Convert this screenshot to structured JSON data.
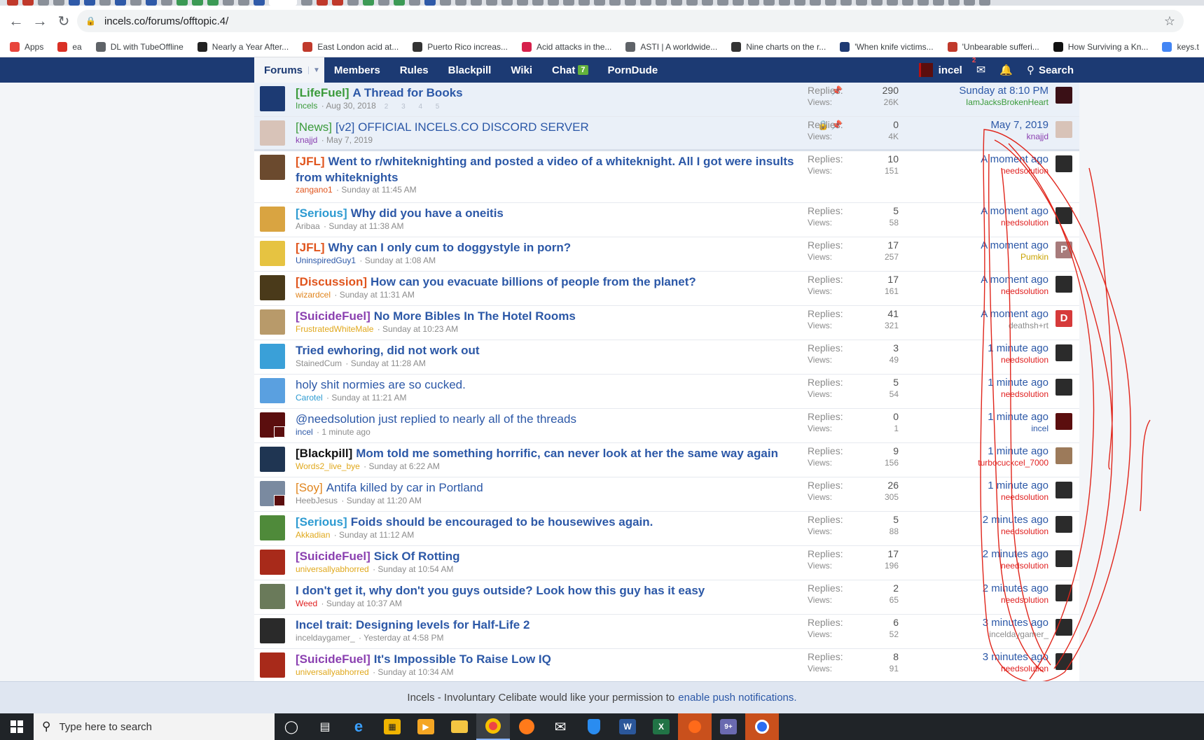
{
  "browser": {
    "url": "incels.co/forums/offtopic.4/",
    "bookmarks": [
      {
        "label": "Apps",
        "icon": "apps-grid-icon",
        "color": "#e8453c"
      },
      {
        "label": "ea",
        "icon": "gmail-icon",
        "color": "#d93025"
      },
      {
        "label": "DL with TubeOffline",
        "icon": "globe-icon",
        "color": "#5f6368"
      },
      {
        "label": "Nearly a Year After...",
        "icon": "nytimes-icon",
        "color": "#222222"
      },
      {
        "label": "East London acid at...",
        "icon": "red-heart-icon",
        "color": "#c0392b"
      },
      {
        "label": "Puerto Rico increas...",
        "icon": "news-site-icon",
        "color": "#333333"
      },
      {
        "label": "Acid attacks in the...",
        "icon": "s-logo-icon",
        "color": "#d6204b"
      },
      {
        "label": "ASTI | A worldwide...",
        "icon": "globe-icon",
        "color": "#5f6368"
      },
      {
        "label": "Nine charts on the r...",
        "icon": "news-site-icon",
        "color": "#333333"
      },
      {
        "label": "'When knife victims...",
        "icon": "facebook-like-icon",
        "color": "#1e3a73"
      },
      {
        "label": "'Unbearable sufferi...",
        "icon": "red-heart-icon",
        "color": "#c0392b"
      },
      {
        "label": "How Surviving a Kn...",
        "icon": "black-square-icon",
        "color": "#111111"
      },
      {
        "label": "keys.t",
        "icon": "doc-icon",
        "color": "#4285f4"
      }
    ]
  },
  "nav": {
    "tabs": [
      {
        "label": "Forums",
        "active": true
      },
      {
        "label": "Members"
      },
      {
        "label": "Rules"
      },
      {
        "label": "Blackpill"
      },
      {
        "label": "Wiki"
      },
      {
        "label": "Chat",
        "badge": "7"
      },
      {
        "label": "PornDude"
      }
    ],
    "user": "incel",
    "mail_badge": "2",
    "search": "Search"
  },
  "labels": {
    "replies": "Replies:",
    "views": "Views:"
  },
  "threads": [
    {
      "prefix": "[LifeFuel]",
      "prefix_color": "#3a9a3a",
      "title": "A Thread for Books",
      "bold": true,
      "author": "Incels",
      "author_color": "#3a9a3a",
      "date": "Aug 30, 2018",
      "pages": "2 3 4 5",
      "sticky": true,
      "pinned": true,
      "locked": false,
      "replies": "290",
      "views": "26K",
      "last_time": "Sunday at 8:10 PM",
      "last_user": "IamJacksBrokenHeart",
      "last_user_color": "#3a9a3a",
      "avatar_color": "#1c3a73",
      "last_avatar_color": "#3a1016"
    },
    {
      "prefix": "[News]",
      "prefix_color": "#3a9a3a",
      "title": "[v2] OFFICIAL INCELS.CO DISCORD SERVER",
      "bold": false,
      "author": "knajjd",
      "author_color": "#8a3fb0",
      "date": "May 7, 2019",
      "sticky": true,
      "last_sticky": true,
      "pinned": true,
      "locked": true,
      "replies": "0",
      "views": "4K",
      "last_time": "May 7, 2019",
      "last_user": "knajjd",
      "last_user_color": "#8a3fb0",
      "avatar_color": "#d8c3b8",
      "last_avatar_color": "#d8c3b8"
    },
    {
      "prefix": "[JFL]",
      "prefix_color": "#e0541c",
      "title": "Went to r/whiteknighting and posted a video of a whiteknight. All I got were insults from whiteknights",
      "bold": true,
      "tall": true,
      "author": "zangano1",
      "author_color": "#e0541c",
      "date": "Sunday at 11:45 AM",
      "replies": "10",
      "views": "151",
      "last_time": "A moment ago",
      "last_user": "needsolution",
      "last_user_color": "#e02020",
      "avatar_color": "#6b4a2e",
      "last_avatar_color": "#2b2b2b"
    },
    {
      "prefix": "[Serious]",
      "prefix_color": "#2c9ad1",
      "title": "Why did you have a oneitis",
      "bold": true,
      "author": "Aribaa",
      "author_color": "#8c8c8c",
      "date": "Sunday at 11:38 AM",
      "replies": "5",
      "views": "58",
      "last_time": "A moment ago",
      "last_user": "needsolution",
      "last_user_color": "#e02020",
      "avatar_color": "#d9a441",
      "last_avatar_color": "#2b2b2b"
    },
    {
      "prefix": "[JFL]",
      "prefix_color": "#e0541c",
      "title": "Why can I only cum to doggystyle in porn?",
      "bold": true,
      "author": "UninspiredGuy1",
      "author_color": "#2c58a7",
      "date": "Sunday at 1:08 AM",
      "replies": "17",
      "views": "257",
      "last_time": "A moment ago",
      "last_user": "Pumkin",
      "last_user_color": "#c9a300",
      "avatar_color": "#e6c341",
      "last_avatar_color": "#a77b7b",
      "last_avatar_letter": "P"
    },
    {
      "prefix": "[Discussion]",
      "prefix_color": "#e0541c",
      "title": "How can you evacuate billions of people from the planet?",
      "bold": true,
      "author": "wizardcel",
      "author_color": "#e0841c",
      "date": "Sunday at 11:31 AM",
      "replies": "17",
      "views": "161",
      "last_time": "A moment ago",
      "last_user": "needsolution",
      "last_user_color": "#e02020",
      "avatar_color": "#4a3a1a",
      "last_avatar_color": "#2b2b2b"
    },
    {
      "prefix": "[SuicideFuel]",
      "prefix_color": "#8a3fb0",
      "title": "No More Bibles In The Hotel Rooms",
      "bold": true,
      "author": "FrustratedWhiteMale",
      "author_color": "#e0a81c",
      "date": "Sunday at 10:23 AM",
      "replies": "41",
      "views": "321",
      "last_time": "A moment ago",
      "last_user": "deathsh+rt",
      "last_user_color": "#8c8c8c",
      "avatar_color": "#b89a6a",
      "last_avatar_color": "#d63a3a",
      "last_avatar_letter": "D"
    },
    {
      "prefix": "",
      "prefix_color": "#2c58a7",
      "title": "Tried ewhoring, did not work out",
      "bold": true,
      "author": "StainedCum",
      "author_color": "#8c8c8c",
      "date": "Sunday at 11:28 AM",
      "replies": "3",
      "views": "49",
      "last_time": "1 minute ago",
      "last_user": "needsolution",
      "last_user_color": "#e02020",
      "avatar_color": "#3aa0d8",
      "last_avatar_color": "#2b2b2b"
    },
    {
      "prefix": "",
      "prefix_color": "#2c58a7",
      "title": "holy shit normies are so cucked.",
      "bold": false,
      "author": "Carotel",
      "author_color": "#2c9ad1",
      "date": "Sunday at 11:21 AM",
      "replies": "5",
      "views": "54",
      "last_time": "1 minute ago",
      "last_user": "needsolution",
      "last_user_color": "#e02020",
      "avatar_color": "#5aa0e0",
      "last_avatar_color": "#2b2b2b"
    },
    {
      "prefix": "",
      "prefix_color": "#2c58a7",
      "title": "@needsolution just replied to nearly all of the threads",
      "bold": false,
      "author": "incel",
      "author_color": "#2c58a7",
      "date": "1 minute ago",
      "replies": "0",
      "views": "1",
      "last_time": "1 minute ago",
      "last_user": "incel",
      "last_user_color": "#2c58a7",
      "avatar_color": "#5b0e0e",
      "last_avatar_color": "#5b0e0e",
      "mini": true
    },
    {
      "prefix": "[Blackpill]",
      "prefix_color": "#111111",
      "title": "Mom told me something horrific, can never look at her the same way again",
      "bold": true,
      "author": "Words2_live_bye",
      "author_color": "#e0a81c",
      "date": "Sunday at 6:22 AM",
      "replies": "9",
      "views": "156",
      "last_time": "1 minute ago",
      "last_user": "turbocuckcel_7000",
      "last_user_color": "#e02020",
      "avatar_color": "#1f3552",
      "last_avatar_color": "#9c7a5a"
    },
    {
      "prefix": "[Soy]",
      "prefix_color": "#e0841c",
      "title": "Antifa killed by car in Portland",
      "bold": false,
      "author": "HeebJesus",
      "author_color": "#8c8c8c",
      "date": "Sunday at 11:20 AM",
      "replies": "26",
      "views": "305",
      "last_time": "1 minute ago",
      "last_user": "needsolution",
      "last_user_color": "#e02020",
      "avatar_color": "#7a8aa0",
      "last_avatar_color": "#2b2b2b",
      "mini": true
    },
    {
      "prefix": "[Serious]",
      "prefix_color": "#2c9ad1",
      "title": "Foids should be encouraged to be housewives again.",
      "bold": true,
      "author": "Akkadian",
      "author_color": "#e0a81c",
      "date": "Sunday at 11:12 AM",
      "replies": "5",
      "views": "88",
      "last_time": "2 minutes ago",
      "last_user": "needsolution",
      "last_user_color": "#e02020",
      "avatar_color": "#4f8a3a",
      "last_avatar_color": "#2b2b2b"
    },
    {
      "prefix": "[SuicideFuel]",
      "prefix_color": "#8a3fb0",
      "title": "Sick Of Rotting",
      "bold": true,
      "author": "universallyabhorred",
      "author_color": "#e0a81c",
      "date": "Sunday at 10:54 AM",
      "replies": "17",
      "views": "196",
      "last_time": "2 minutes ago",
      "last_user": "needsolution",
      "last_user_color": "#e02020",
      "avatar_color": "#a82a1a",
      "last_avatar_color": "#2b2b2b"
    },
    {
      "prefix": "",
      "prefix_color": "#2c58a7",
      "title": "I don't get it, why don't you guys outside? Look how this guy has it easy",
      "bold": true,
      "author": "Weed",
      "author_color": "#e02020",
      "date": "Sunday at 10:37 AM",
      "replies": "2",
      "views": "65",
      "last_time": "2 minutes ago",
      "last_user": "needsolution",
      "last_user_color": "#e02020",
      "avatar_color": "#6a7a5a",
      "last_avatar_color": "#2b2b2b"
    },
    {
      "prefix": "",
      "prefix_color": "#2c58a7",
      "title": "Incel trait: Designing levels for Half-Life 2",
      "bold": true,
      "author": "inceldaygamer_",
      "author_color": "#8c8c8c",
      "date": "Yesterday at 4:58 PM",
      "replies": "6",
      "views": "52",
      "last_time": "3 minutes ago",
      "last_user": "inceldaygamer_",
      "last_user_color": "#8c8c8c",
      "avatar_color": "#2a2a2a",
      "last_avatar_color": "#2a2a2a"
    },
    {
      "prefix": "[SuicideFuel]",
      "prefix_color": "#8a3fb0",
      "title": "It's Impossible To Raise Low IQ",
      "bold": true,
      "author": "universallyabhorred",
      "author_color": "#e0a81c",
      "date": "Sunday at 10:34 AM",
      "replies": "8",
      "views": "91",
      "last_time": "3 minutes ago",
      "last_user": "needsolution",
      "last_user_color": "#e02020",
      "avatar_color": "#a82a1a",
      "last_avatar_color": "#2b2b2b"
    }
  ],
  "push": {
    "text": "Incels - Involuntary Celibate would like your permission to",
    "link": "enable push notifications."
  },
  "taskbar": {
    "search_placeholder": "Type here to search",
    "apps": [
      "cortana-icon",
      "task-view-icon",
      "edge-icon",
      "store-icon",
      "media-player-icon",
      "file-explorer-icon",
      "chrome-icon",
      "firefox-icon",
      "mail-icon",
      "defender-icon",
      "word-icon",
      "excel-icon",
      "app-orange-icon",
      "chat-app-icon",
      "app-blue-circle-icon"
    ]
  }
}
